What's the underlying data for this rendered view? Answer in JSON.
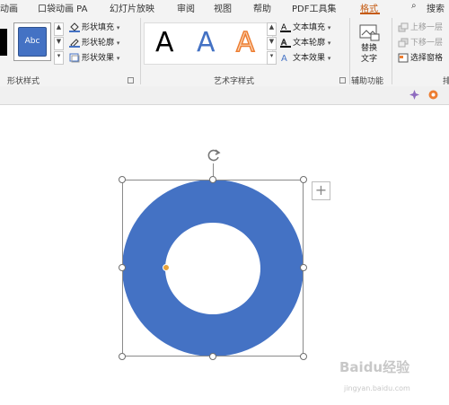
{
  "tabs": [
    "动画",
    "口袋动画 PA",
    "幻灯片放映",
    "审阅",
    "视图",
    "帮助",
    "PDF工具集",
    "格式",
    "搜索"
  ],
  "active_tab": "格式",
  "shape_styles": {
    "sample_label": "Abc",
    "fill": "形状填充",
    "outline": "形状轮廓",
    "effect": "形状效果",
    "group_label": "形状样式"
  },
  "wordart": {
    "samples": [
      "A",
      "A",
      "A"
    ],
    "text_fill": "文本填充",
    "text_outline": "文本轮廓",
    "text_effect": "文本效果",
    "group_label": "艺术字样式"
  },
  "accessibility": {
    "alt_text_line1": "替换",
    "alt_text_line2": "文字",
    "group_label": "辅助功能"
  },
  "arrange": {
    "bring_forward": "上移一层",
    "send_backward": "下移一层",
    "selection_pane": "选择窗格",
    "group_label_partial": "排"
  },
  "canvas": {
    "plus_button": "+",
    "watermark": "Baidu经验",
    "watermark_url": "jingyan.baidu.com"
  },
  "colors": {
    "shape_fill": "#4472c4",
    "accent_tab": "#c55a11",
    "adjust_handle": "#e8a33c"
  }
}
